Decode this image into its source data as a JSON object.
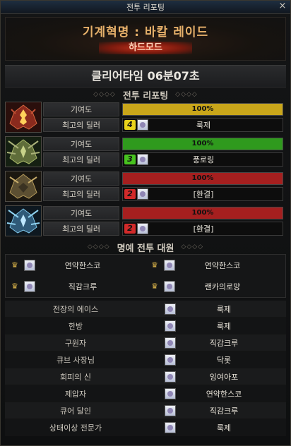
{
  "window": {
    "title": "전투 리포팅",
    "close_label": "×"
  },
  "header": {
    "dungeon_title": "기계혁명 : 바칼 레이드",
    "mode": "하드모드"
  },
  "clear": {
    "text": "클리어타임   06분07초"
  },
  "sections": {
    "battle_report": "전투 리포팅",
    "honor": "명예 전투 대원",
    "deco_left": "◇◇◇◇",
    "deco_right": "◇◇◇◇"
  },
  "bosses": [
    {
      "icon": "red-dragon-icon",
      "contribution_label": "기여도",
      "contribution_text": "100%",
      "contribution": 1.0,
      "bar_color": "#c9a61a",
      "dealer_label": "최고의 딜러",
      "rank": "4",
      "rank_color": "#e8d21b",
      "dealer": "룩제"
    },
    {
      "icon": "green-dragon-icon",
      "contribution_label": "기여도",
      "contribution_text": "100%",
      "contribution": 1.0,
      "bar_color": "#2f9a1d",
      "dealer_label": "최고의 딜러",
      "rank": "3",
      "rank_color": "#47c21f",
      "dealer": "풍로링"
    },
    {
      "icon": "gold-dragon-icon",
      "contribution_label": "기여도",
      "contribution_text": "100%",
      "contribution": 1.0,
      "bar_color": "#a51f1f",
      "dealer_label": "최고의 딜러",
      "rank": "2",
      "rank_color": "#d12a2a",
      "dealer": "[환결]"
    },
    {
      "icon": "blue-dragon-icon",
      "contribution_label": "기여도",
      "contribution_text": "100%",
      "contribution": 1.0,
      "bar_color": "#a51f1f",
      "dealer_label": "최고의 딜러",
      "rank": "2",
      "rank_color": "#d12a2a",
      "dealer": "[환결]"
    }
  ],
  "honor_members": [
    {
      "name": "연약한스코"
    },
    {
      "name": "연약한스코"
    },
    {
      "name": "직감크루"
    },
    {
      "name": "랜카의로망"
    }
  ],
  "awards": [
    {
      "title": "전장의 에이스",
      "player": "룩제"
    },
    {
      "title": "한방",
      "player": "룩제"
    },
    {
      "title": "구원자",
      "player": "직감크루"
    },
    {
      "title": "큐브 사장님",
      "player": "닥롯"
    },
    {
      "title": "회피의 신",
      "player": "잉여아포"
    },
    {
      "title": "제압자",
      "player": "연약한스코"
    },
    {
      "title": "큐어 달인",
      "player": "직감크루"
    },
    {
      "title": "상태이상 전문가",
      "player": "룩제"
    }
  ]
}
